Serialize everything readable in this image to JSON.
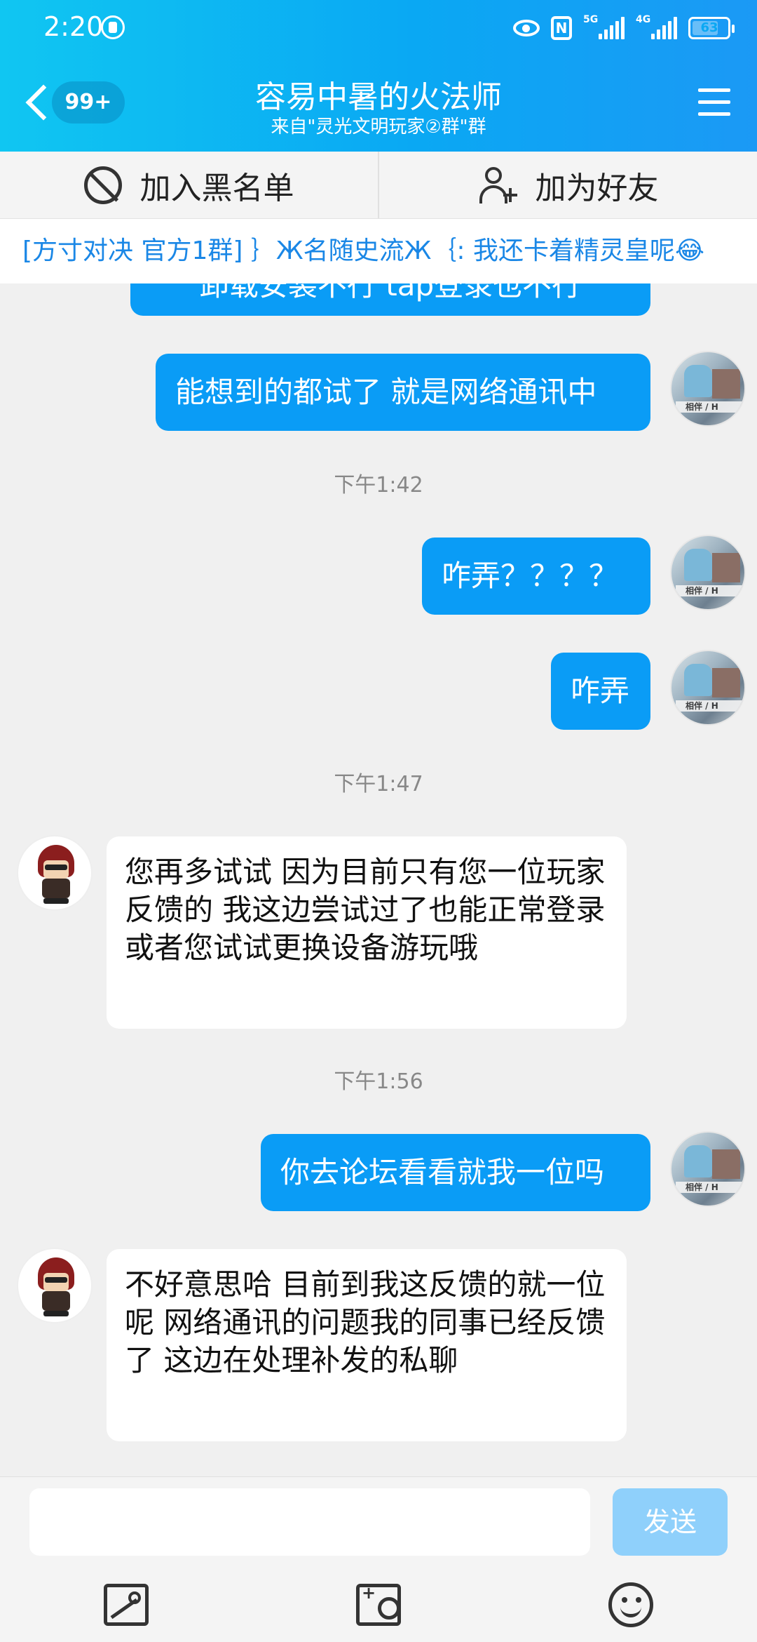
{
  "status_bar": {
    "time": "2:20",
    "battery": "63",
    "network_tags": [
      "5G",
      "4G"
    ]
  },
  "header": {
    "back_badge": "99+",
    "title": "容易中暑的火法师",
    "subtitle": "来自\"灵光文明玩家②群\"群"
  },
  "actions": {
    "blacklist_label": "加入黑名单",
    "add_friend_label": "加为好友"
  },
  "pinned_message": "[方寸对决 官方1群] ｝Ж名随史流Ж｛: 我还卡着精灵皇呢😂",
  "messages": {
    "m0": "卸载安装不行 tap登录也不行",
    "m1": "能想到的都试了 就是网络通讯中",
    "t1": "下午1:42",
    "m2": "咋弄？？？？",
    "m3": "咋弄",
    "t2": "下午1:47",
    "m4": "您再多试试 因为目前只有您一位玩家反馈的 我这边尝试过了也能正常登录 或者您试试更换设备游玩哦",
    "t3": "下午1:56",
    "m5": "你去论坛看看就我一位吗",
    "m6": "不好意思哈 目前到我这反馈的就一位呢 网络通讯的问题我的同事已经反馈了 这边在处理补发的私聊"
  },
  "input": {
    "placeholder": "",
    "send_label": "发送"
  },
  "colors": {
    "accent": "#0a9cf6",
    "header_start": "#10c6f2",
    "send_disabled": "#8fd0fb",
    "pinned_text": "#1a87e6"
  }
}
